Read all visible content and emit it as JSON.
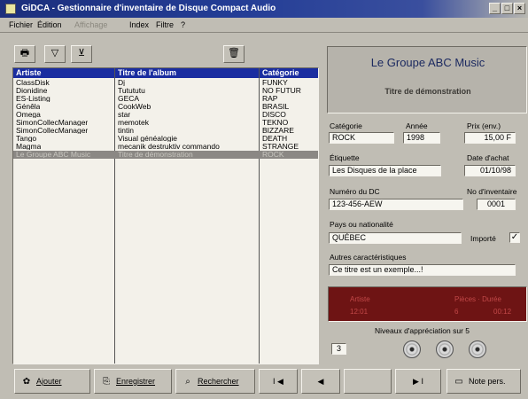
{
  "window": {
    "title": "GiDCA - Gestionnaire d'inventaire de Disque Compact Audio",
    "minimize_glyph": "_",
    "maximize_glyph": "□",
    "close_glyph": "×"
  },
  "menu": {
    "items": [
      {
        "label": "Fichier",
        "disabled": false
      },
      {
        "label": "Édition",
        "disabled": false
      },
      {
        "label": "Affichage",
        "disabled": true
      },
      {
        "label": "Index",
        "disabled": false
      },
      {
        "label": "Filtre",
        "disabled": false
      },
      {
        "label": "?",
        "disabled": false
      }
    ]
  },
  "toolbar": {
    "icons": [
      "printer-icon",
      "filter-icon",
      "filter-clear-icon",
      "trash-icon"
    ],
    "glyphs": {
      "print": "🖶",
      "filter": "▽",
      "filter_clear": "⊻",
      "delete": "🗑"
    }
  },
  "list": {
    "columns": [
      "Artiste",
      "Titre de l'album",
      "Catégorie"
    ],
    "rows": [
      [
        "ClassDisk",
        "Dj",
        "FUNKY"
      ],
      [
        "Dionidine",
        "Tutututu",
        "NO FUTUR"
      ],
      [
        "ES-Listing",
        "GECA",
        "RAP"
      ],
      [
        "Génêla",
        "CookWeb",
        "BRASIL"
      ],
      [
        "Omega",
        "star",
        "DISCO"
      ],
      [
        "SimonCollecManager",
        "memotek",
        "TEKNO"
      ],
      [
        "SimonCollecManager",
        "tintin",
        "BIZZARE"
      ],
      [
        "Tango",
        "Visual généalogie",
        "DEATH"
      ],
      [
        "Magma",
        "mecanik destruktiv commando",
        "STRANGE"
      ],
      [
        "Le Groupe ABC Music",
        "Titre de démonstration",
        "ROCK"
      ]
    ],
    "selected_index": 9
  },
  "detail": {
    "banner_title": "Le Groupe ABC Music",
    "banner_subtitle": "Titre de démonstration",
    "categorie_label": "Catégorie",
    "categorie_value": "ROCK",
    "annee_label": "Année",
    "annee_value": "1998",
    "prix_label": "Prix (env.)",
    "prix_value": "15,00 F",
    "etiquette_label": "Étiquette",
    "etiquette_value": "Les Disques de la place",
    "date_achat_label": "Date d'achat",
    "date_achat_value": "01/10/98",
    "numero_dc_label": "Numéro du DC",
    "numero_dc_value": "123-456-AEW",
    "no_inventaire_label": "No d'inventaire",
    "no_inventaire_value": "0001",
    "pays_label": "Pays ou nationalité",
    "pays_value": "QUÉBEC",
    "importe_label": "Importé",
    "importe_checked": true,
    "check_glyph": "✓",
    "autres_label": "Autres caractéristiques",
    "autres_value": "Ce titre est un exemple...!",
    "niveaux_label": "Niveaux d'appréciation sur 5",
    "niveau_value": "3",
    "disc_icons": [
      "cd-icon",
      "cd-icon",
      "cd-icon"
    ]
  },
  "status": {
    "line1_left": "Artiste",
    "line1_right": "Pièces · Durée",
    "line2_left": "12:01",
    "line2_mid": "6",
    "line2_right": "00:12"
  },
  "bottom": {
    "add_label": "Ajouter",
    "save_label": "Enregistrer",
    "search_label": "Rechercher",
    "note_label": "Note pers.",
    "glyphs": {
      "add": "✿",
      "save": "⎘",
      "search": "⌕",
      "note": "▭"
    },
    "nav": {
      "first": "I ◀",
      "prev": "◀",
      "next": "▶ I"
    }
  },
  "colors": {
    "title_bar": "#1c2f7c",
    "list_header": "#1a2da0",
    "banner_text": "#1c2a60",
    "status_panel": "#6e1414",
    "status_text": "#c24848"
  }
}
